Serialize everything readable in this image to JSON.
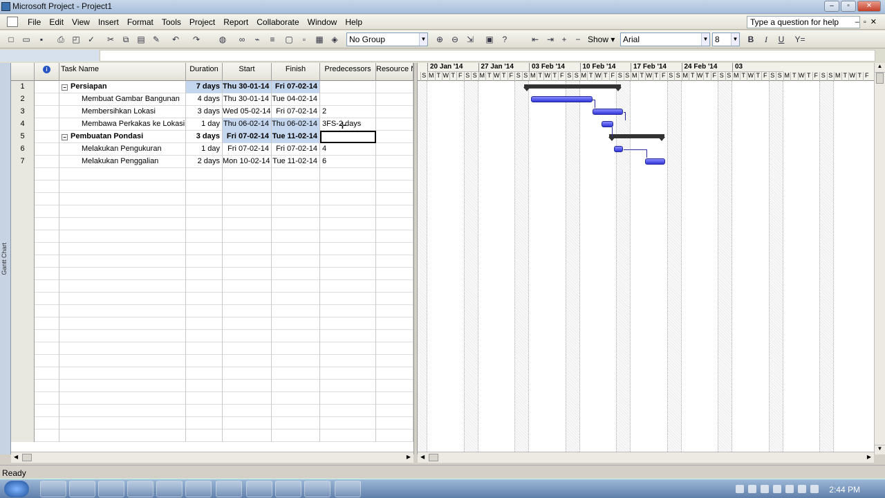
{
  "window": {
    "title": "Microsoft Project - Project1"
  },
  "menu": [
    "File",
    "Edit",
    "View",
    "Insert",
    "Format",
    "Tools",
    "Project",
    "Report",
    "Collaborate",
    "Window",
    "Help"
  ],
  "help_box": "Type a question for help",
  "toolbar": {
    "group": "No Group",
    "show": "Show",
    "font": "Arial",
    "size": "8",
    "bold": "B",
    "italic": "I",
    "underline": "U",
    "filter": "Y="
  },
  "sidebar_label": "Gantt Chart",
  "columns": [
    "Task Name",
    "Duration",
    "Start",
    "Finish",
    "Predecessors",
    "Resource N"
  ],
  "tasks": [
    {
      "id": "1",
      "name": "Persiapan",
      "duration": "7 days",
      "start": "Thu 30-01-14",
      "finish": "Fri 07-02-14",
      "pred": "",
      "summary": true
    },
    {
      "id": "2",
      "name": "Membuat Gambar Bangunan",
      "duration": "4 days",
      "start": "Thu 30-01-14",
      "finish": "Tue 04-02-14",
      "pred": ""
    },
    {
      "id": "3",
      "name": "Membersihkan Lokasi",
      "duration": "3 days",
      "start": "Wed 05-02-14",
      "finish": "Fri 07-02-14",
      "pred": "2"
    },
    {
      "id": "4",
      "name": "Membawa Perkakas ke Lokasi",
      "duration": "1 day",
      "start": "Thu 06-02-14",
      "finish": "Thu 06-02-14",
      "pred": "3FS-2 days"
    },
    {
      "id": "5",
      "name": "Pembuatan Pondasi",
      "duration": "3 days",
      "start": "Fri 07-02-14",
      "finish": "Tue 11-02-14",
      "pred": "",
      "summary": true
    },
    {
      "id": "6",
      "name": "Melakukan Pengukuran",
      "duration": "1 day",
      "start": "Fri 07-02-14",
      "finish": "Fri 07-02-14",
      "pred": "4"
    },
    {
      "id": "7",
      "name": "Melakukan Penggalian",
      "duration": "2 days",
      "start": "Mon 10-02-14",
      "finish": "Tue 11-02-14",
      "pred": "6"
    }
  ],
  "row_numbers": [
    "1",
    "2",
    "3",
    "4",
    "5",
    "6",
    "7"
  ],
  "weeks": [
    "20 Jan '14",
    "27 Jan '14",
    "03 Feb '14",
    "10 Feb '14",
    "17 Feb '14",
    "24 Feb '14",
    "03"
  ],
  "day_letters": [
    "S",
    "M",
    "T",
    "W",
    "T",
    "F",
    "S"
  ],
  "status": "Ready",
  "clock": "2:44 PM",
  "colors": {
    "bar": "#3a3ee0",
    "highlight": "#c5d6ef",
    "summary": "#333333"
  }
}
